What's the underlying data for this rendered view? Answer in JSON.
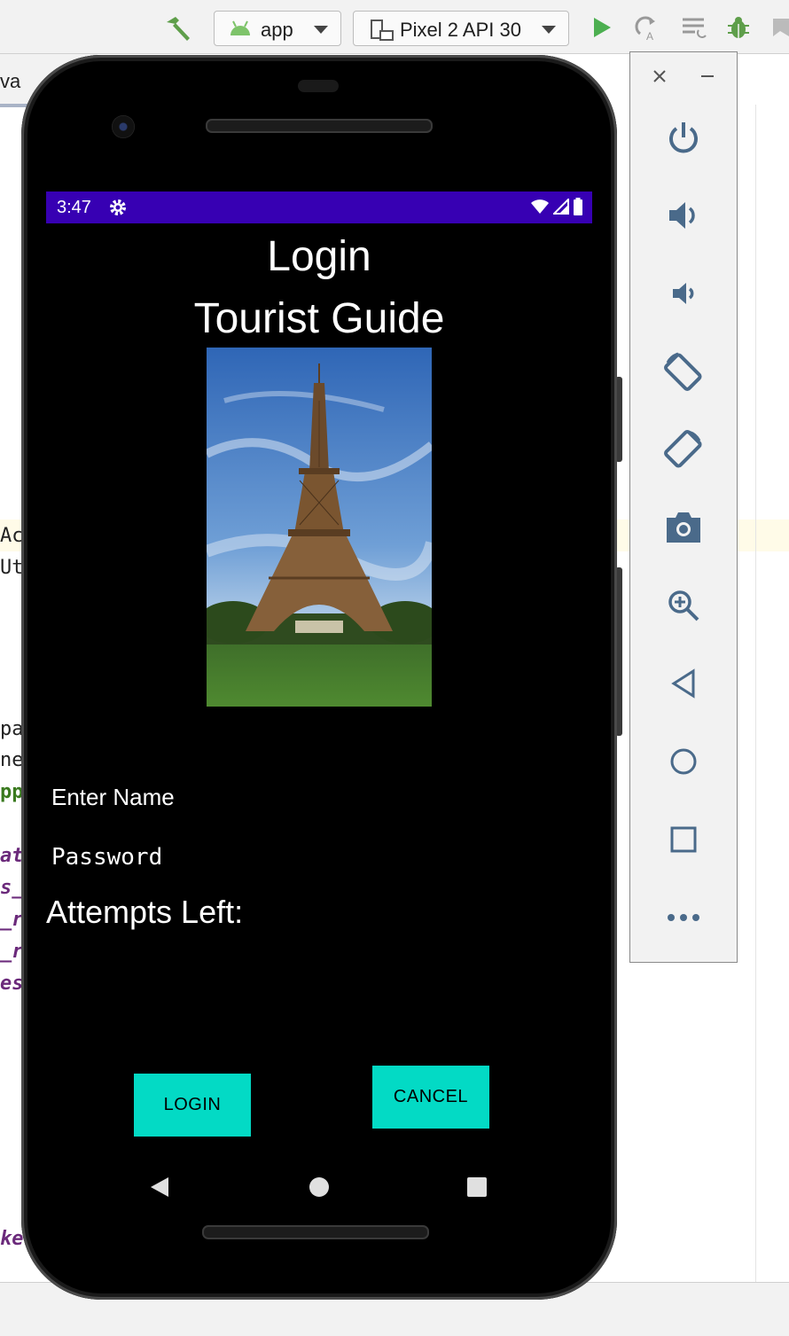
{
  "ide": {
    "run_config": "app",
    "device": "Pixel 2 API 30",
    "editor_tab_label": "va",
    "code_fragments": [
      "Ac",
      "Ut",
      "pa",
      "ne",
      "pp",
      "at",
      "s_",
      "_r",
      "_r",
      "es",
      "ke"
    ]
  },
  "phone": {
    "status": {
      "time": "3:47"
    },
    "title_line1": "Login",
    "title_line2": "Tourist Guide",
    "name_hint": "Enter Name",
    "password_hint": "Password",
    "attempts_label": "Attempts Left:",
    "login_button": "LOGIN",
    "cancel_button": "CANCEL"
  },
  "colors": {
    "status_bar": "#3700b3",
    "button": "#03dac5"
  }
}
